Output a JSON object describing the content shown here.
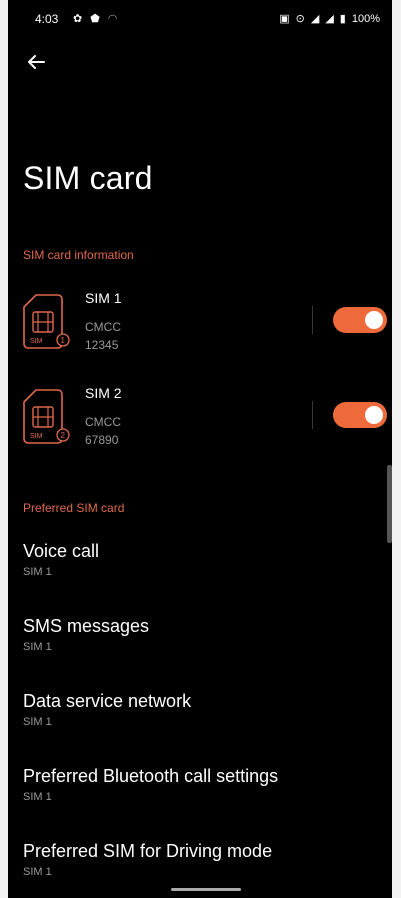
{
  "status_bar": {
    "time": "4:03",
    "battery_percent": "100%",
    "icons": [
      "settings-icon",
      "shield-icon",
      "wifi-icon",
      "nfc-icon",
      "vpn-icon",
      "signal-icon",
      "signal-icon-2",
      "battery-icon"
    ]
  },
  "header": {
    "title": "SIM card"
  },
  "sim_info": {
    "section_label": "SIM card information",
    "sims": [
      {
        "name": "SIM 1",
        "carrier": "CMCC",
        "number": "12345",
        "badge": "1",
        "enabled": true
      },
      {
        "name": "SIM 2",
        "carrier": "CMCC",
        "number": "67890",
        "badge": "2",
        "enabled": true
      }
    ]
  },
  "preferred": {
    "section_label": "Preferred SIM card",
    "items": [
      {
        "title": "Voice call",
        "value": "SIM 1"
      },
      {
        "title": "SMS messages",
        "value": "SIM 1"
      },
      {
        "title": "Data service network",
        "value": "SIM 1"
      },
      {
        "title": "Preferred Bluetooth call settings",
        "value": "SIM 1"
      },
      {
        "title": "Preferred SIM for Driving mode",
        "value": "SIM 1"
      }
    ]
  },
  "colors": {
    "accent": "#ee6a3a",
    "section_label": "#e0694b",
    "background": "#000000"
  }
}
